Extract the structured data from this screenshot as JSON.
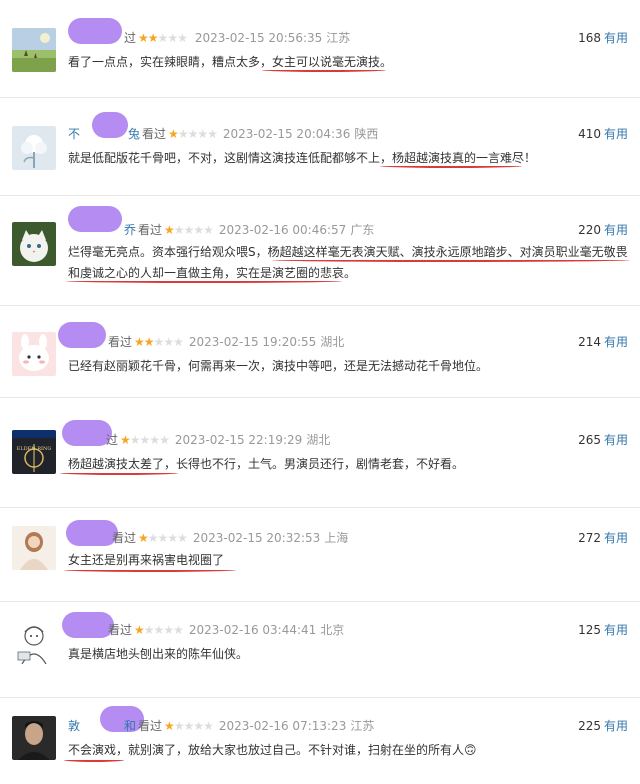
{
  "colors": {
    "link": "#3377aa",
    "star": "#f5a623",
    "underline": "#d93b3b",
    "redact": "#b48cf2"
  },
  "reviews": [
    {
      "user": "",
      "watched": "过",
      "stars": 2,
      "time": "2023-02-15 20:56:35",
      "location": "江苏",
      "votes": "168",
      "vote_label": "有用",
      "content_a": "看了一点点，实在辣眼睛，糟点太多，",
      "content_b": "女主可以说毫无演技。",
      "avatar": "landscape-avatar"
    },
    {
      "user": "不",
      "user_tail": "兔",
      "watched": "看过",
      "stars": 1,
      "time": "2023-02-15 20:04:36",
      "location": "陕西",
      "votes": "410",
      "vote_label": "有用",
      "content_a": "就是低配版花千骨吧，不对，这剧情这演技连低配都够不上，",
      "content_b": "杨超越演技真的一言难尽！",
      "avatar": "flower-avatar"
    },
    {
      "user": "",
      "user_tail": "乔",
      "watched": "看过",
      "stars": 1,
      "time": "2023-02-16 00:46:57",
      "location": "广东",
      "votes": "220",
      "vote_label": "有用",
      "content_a": "烂得毫无亮点。资本强行给观众喂S，",
      "content_b": "杨超越这样毫无表演天赋、演技永远原地踏步、对演员职业毫无敬畏",
      "content_c": "和虔诚之心的人却一直做主角，实在是演艺圈的悲哀。",
      "avatar": "cat-avatar"
    },
    {
      "user": "",
      "watched": "看过",
      "stars": 2,
      "time": "2023-02-15 19:20:55",
      "location": "湖北",
      "votes": "214",
      "vote_label": "有用",
      "content_a": "已经有赵丽颖花千骨，何需再来一次，演技中等吧，还是无法撼动花千骨地位。",
      "avatar": "bunny-avatar"
    },
    {
      "user": "",
      "watched": "过",
      "stars": 1,
      "time": "2023-02-15 22:19:29",
      "location": "湖北",
      "votes": "265",
      "vote_label": "有用",
      "content_a": "杨超越演技太差了，",
      "content_b": "长得也不行，土气。男演员还行，剧情老套，不好看。",
      "avatar": "eldenring-avatar",
      "avatar_text": "ELDEN RING"
    },
    {
      "user": "",
      "watched": "看过",
      "stars": 1,
      "time": "2023-02-15 20:32:53",
      "location": "上海",
      "votes": "272",
      "vote_label": "有用",
      "content_a": "女主还是别再来祸害电视圈了",
      "avatar": "girl-avatar"
    },
    {
      "user": "",
      "watched": "看过",
      "stars": 1,
      "time": "2023-02-16 03:44:41",
      "location": "北京",
      "votes": "125",
      "vote_label": "有用",
      "content_a": "真是横店地头刨出来的陈年仙侠。",
      "avatar": "sketch-avatar"
    },
    {
      "user": "敦",
      "user_tail": "和",
      "watched": "看过",
      "stars": 1,
      "time": "2023-02-16 07:13:23",
      "location": "江苏",
      "votes": "225",
      "vote_label": "有用",
      "content_a": "不会演戏",
      "content_b": "，就别演了，放给大家也放过自己。不针对谁，扫射在坐的所有人",
      "emoji": "🙃",
      "avatar": "man-avatar"
    }
  ]
}
